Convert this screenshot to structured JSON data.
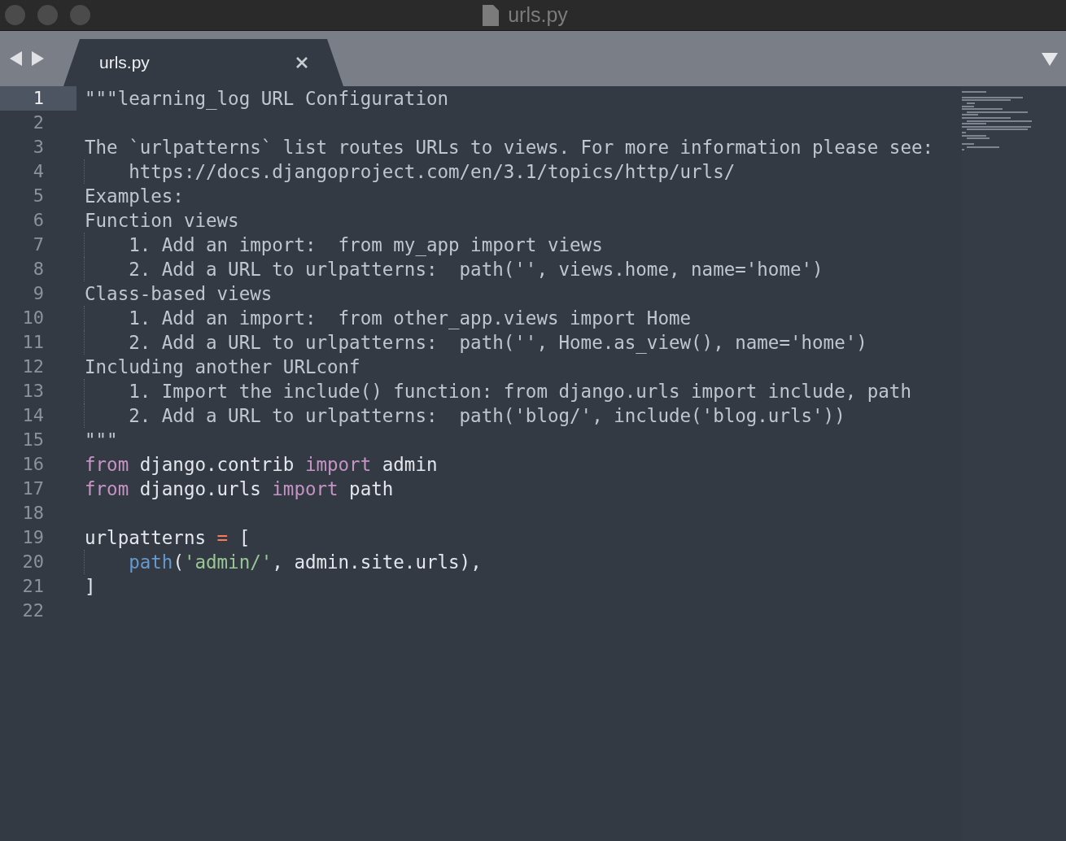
{
  "window": {
    "title": "urls.py"
  },
  "tabs": [
    {
      "label": "urls.py",
      "selected": true
    }
  ],
  "lines": [
    {
      "number": "1",
      "current": true,
      "indented": false,
      "tokens": [
        {
          "kind": "doc",
          "text": "\"\"\"learning_log URL Configuration"
        }
      ]
    },
    {
      "number": "2",
      "current": false
    },
    {
      "number": "3",
      "current": false,
      "indented": false,
      "tokens": [
        {
          "kind": "doc",
          "text": "The `urlpatterns` list routes URLs to views. For more information please see:"
        }
      ]
    },
    {
      "number": "4",
      "current": false,
      "indented": true,
      "tokens": [
        {
          "kind": "doc",
          "text": "https://docs.djangoproject.com/en/3.1/topics/http/urls/"
        }
      ]
    },
    {
      "number": "5",
      "current": false,
      "indented": false,
      "tokens": [
        {
          "kind": "doc",
          "text": "Examples:"
        }
      ]
    },
    {
      "number": "6",
      "current": false,
      "indented": false,
      "tokens": [
        {
          "kind": "doc",
          "text": "Function views"
        }
      ]
    },
    {
      "number": "7",
      "current": false,
      "indented": true,
      "tokens": [
        {
          "kind": "doc",
          "text": "1. Add an import:  from my_app import views"
        }
      ]
    },
    {
      "number": "8",
      "current": false,
      "indented": true,
      "tokens": [
        {
          "kind": "doc",
          "text": "2. Add a URL to urlpatterns:  path('', views.home, name='home')"
        }
      ]
    },
    {
      "number": "9",
      "current": false,
      "indented": false,
      "tokens": [
        {
          "kind": "doc",
          "text": "Class-based views"
        }
      ]
    },
    {
      "number": "10",
      "current": false,
      "indented": true,
      "tokens": [
        {
          "kind": "doc",
          "text": "1. Add an import:  from other_app.views import Home"
        }
      ]
    },
    {
      "number": "11",
      "current": false,
      "indented": true,
      "tokens": [
        {
          "kind": "doc",
          "text": "2. Add a URL to urlpatterns:  path('', Home.as_view(), name='home')"
        }
      ]
    },
    {
      "number": "12",
      "current": false,
      "indented": false,
      "tokens": [
        {
          "kind": "doc",
          "text": "Including another URLconf"
        }
      ]
    },
    {
      "number": "13",
      "current": false,
      "indented": true,
      "tokens": [
        {
          "kind": "doc",
          "text": "1. Import the include() function: from django.urls import include, path"
        }
      ]
    },
    {
      "number": "14",
      "current": false,
      "indented": true,
      "tokens": [
        {
          "kind": "doc",
          "text": "2. Add a URL to urlpatterns:  path('blog/', include('blog.urls'))"
        }
      ]
    },
    {
      "number": "15",
      "current": false,
      "indented": false,
      "tokens": [
        {
          "kind": "doc",
          "text": "\"\"\""
        }
      ]
    },
    {
      "number": "16",
      "current": false,
      "indented": false,
      "tokens": [
        {
          "kind": "keyword",
          "text": "from"
        },
        {
          "kind": "plain",
          "text": " django.contrib "
        },
        {
          "kind": "keyword",
          "text": "import"
        },
        {
          "kind": "plain",
          "text": " admin"
        }
      ]
    },
    {
      "number": "17",
      "current": false,
      "indented": false,
      "tokens": [
        {
          "kind": "keyword",
          "text": "from"
        },
        {
          "kind": "plain",
          "text": " django.urls "
        },
        {
          "kind": "keyword",
          "text": "import"
        },
        {
          "kind": "plain",
          "text": " path"
        }
      ]
    },
    {
      "number": "18",
      "current": false
    },
    {
      "number": "19",
      "current": false,
      "indented": false,
      "tokens": [
        {
          "kind": "plain",
          "text": "urlpatterns "
        },
        {
          "kind": "operator",
          "text": "="
        },
        {
          "kind": "plain",
          "text": " ["
        }
      ]
    },
    {
      "number": "20",
      "current": false,
      "indented": true,
      "tokens": [
        {
          "kind": "function",
          "text": "path"
        },
        {
          "kind": "plain",
          "text": "("
        },
        {
          "kind": "string",
          "text": "'admin/'"
        },
        {
          "kind": "plain",
          "text": ", admin.site.urls),"
        }
      ]
    },
    {
      "number": "21",
      "current": false,
      "indented": false,
      "tokens": [
        {
          "kind": "plain",
          "text": "]"
        }
      ]
    },
    {
      "number": "22",
      "current": false
    }
  ]
}
